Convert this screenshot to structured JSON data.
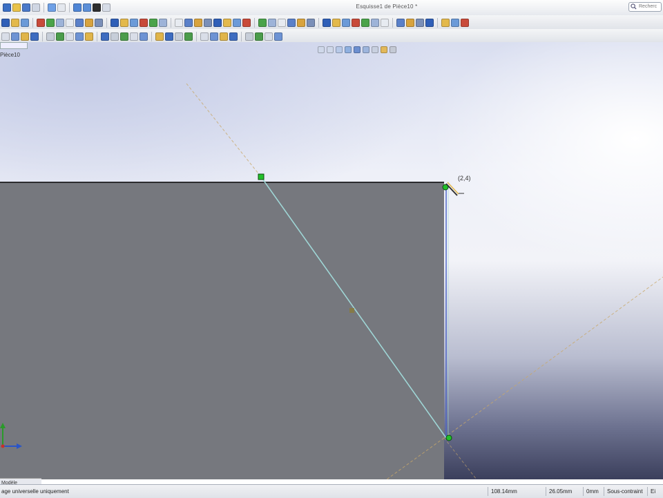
{
  "window": {
    "title": "Esquisse1 de Pièce10 *",
    "search_placeholder": "Recherc"
  },
  "viewport": {
    "label": "Pièce10",
    "corner_label": "(2,4)"
  },
  "bottom_tab": {
    "label": "Modèle"
  },
  "status_bar": {
    "message": "age universelle uniquement",
    "x_value": "108.14mm",
    "y_value": "26.05mm",
    "z_value": "0mm",
    "constraint": "Sous-contraint",
    "units": "Ei"
  },
  "colors": {
    "face": "#76787e",
    "sketch_line": "#9fd6d6",
    "construction_line": "#c9a86a",
    "endpoint": "#22c02a"
  }
}
